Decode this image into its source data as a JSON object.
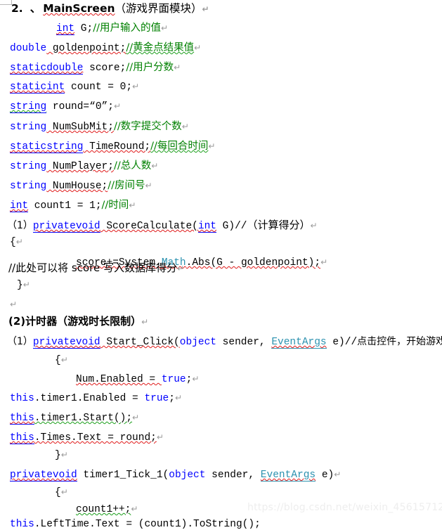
{
  "document": {
    "watermark": "https://blog.csdn.net/weixin_45615712",
    "return_mark": "↵",
    "colors": {
      "keyword": "#0000ff",
      "type": "#2b91af",
      "comment": "#008000",
      "plain": "#000000",
      "string": "#a31515",
      "spellcheck_red": "#e01b1b",
      "grammar_green": "#1a9e1a",
      "watermark": "#eeeeee"
    },
    "lines": {
      "l01_num": "2.",
      "l01_sep": "、",
      "l01_title": "MainScreen",
      "l01_paren": "（游戏界面模块）",
      "l02_kw": "int",
      "l02_code": " G;",
      "l02_cmt": "//用户输入的值",
      "l03_kw": "double",
      "l03_code": " goldenpoint;",
      "l03_cmt": "//黄金点结果值",
      "l04_kw": "staticdouble",
      "l04_code": " score;",
      "l04_cmt": "//用户分数",
      "l05_kw": "staticint",
      "l05_code": " count = 0;",
      "l06_kw": "string",
      "l06_code": " round=",
      "l06_str": "“0”",
      "l06_tail": ";",
      "l07_kw": "string",
      "l07_code": " NumSubMit;",
      "l07_cmt": "//数字提交个数",
      "l08_kw": "staticstring",
      "l08_code": " TimeRound;",
      "l08_cmt": "//每回合时间",
      "l09_kw": "string",
      "l09_code": " NumPlayer;",
      "l09_cmt": "//总人数",
      "l10_kw": "string",
      "l10_code": " NumHouse;",
      "l10_cmt": "//房间号",
      "l11_kw": "int",
      "l11_code": " count1 = 1;",
      "l11_cmt": "//时间",
      "l12_num": "（1）",
      "l12_kw": "privatevoid",
      "l12_name": " ScoreCalculate(",
      "l12_kw2": "int",
      "l12_tail": " G)//",
      "l12_cjk": "（计算得分）",
      "l13_brace": "{",
      "l14_code1": "score+=System.",
      "l14_type": "Math",
      "l14_code2": ".Abs(G - goldenpoint);",
      "l15_cmt": "//此处可以将 score 写入数据库得分",
      "l16_brace": "}",
      "l17_sec": "(2)计时器（游戏时长限制）",
      "l18_num": "（1）",
      "l18_kw": "privatevoid",
      "l18_name": " Start_Click(",
      "l18_kw2": "object",
      "l18_mid": " sender, ",
      "l18_type": "EventArgs",
      "l18_tail": " e)//",
      "l18_cjk": "点击控件，开始游戏",
      "l19_brace": "{",
      "l20_code": "Num.Enabled = ",
      "l20_kw": "true",
      "l20_tail": ";",
      "l21_kw": "this",
      "l21_code": ".timer1.Enabled = ",
      "l21_kw2": "true",
      "l21_tail": ";",
      "l22_kw": "this",
      "l22_code": ".timer1.Start();",
      "l23_kw": "this",
      "l23_code": ".Times.Text = round;",
      "l24_brace": "}",
      "l25_kw": "privatevoid",
      "l25_name": " timer1_Tick_1(",
      "l25_kw2": "object",
      "l25_mid": " sender, ",
      "l25_type": "EventArgs",
      "l25_tail": " e)",
      "l26_brace": "{",
      "l27_code": "count1++;",
      "l28_kw": "this",
      "l28_code": ".LeftTime.Text = (count1).ToString();"
    }
  }
}
